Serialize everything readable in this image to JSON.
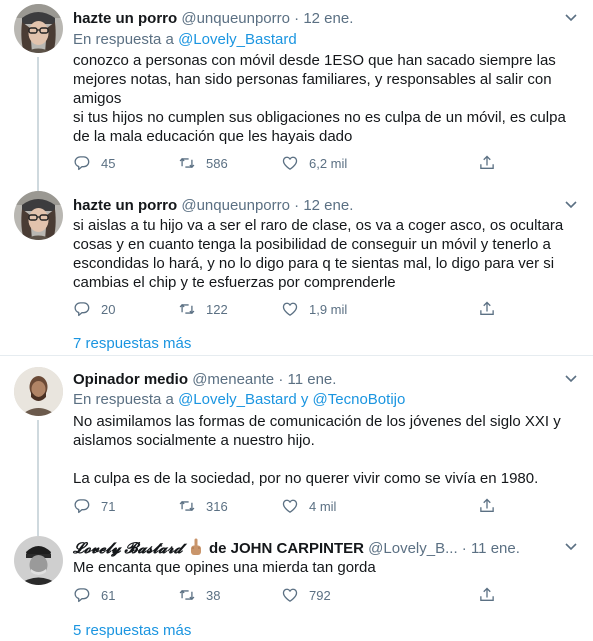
{
  "tweets": [
    {
      "name": "hazte un porro",
      "handle": "@unqueunporro",
      "sep": "·",
      "date": "12 ene.",
      "reply_prefix": "En respuesta a",
      "reply_to": "@Lovely_Bastard",
      "lines": [
        "conozco a personas con móvil desde 1ESO que han sacado siempre las mejores notas, han sido personas familiares, y responsables al salir con amigos",
        "si tus hijos no cumplen sus obligaciones no es culpa de un móvil, es culpa de la mala educación que les hayais dado"
      ],
      "replies": "45",
      "retweets": "586",
      "likes": "6,2 mil"
    },
    {
      "name": "hazte un porro",
      "handle": "@unqueunporro",
      "sep": "·",
      "date": "12 ene.",
      "text": "si aislas a tu hijo va a ser el raro de clase, os va a coger asco, os ocultara cosas y en cuanto tenga la posibilidad de conseguir un móvil y tenerlo a escondidas lo hará, y no lo digo para q te sientas mal, lo digo para ver si cambias el chip y te esfuerzas por comprenderle",
      "replies": "20",
      "retweets": "122",
      "likes": "1,9 mil",
      "more_replies": "7 respuestas más"
    },
    {
      "name": "Opinador medio",
      "handle": "@meneante",
      "sep": "·",
      "date": "11 ene.",
      "reply_prefix": "En respuesta a",
      "reply_to_1": "@Lovely_Bastard",
      "reply_and": "y",
      "reply_to_2": "@TecnoBotijo",
      "lines": [
        "No asimilamos las formas de comunicación de los jóvenes del siglo XXI y aislamos socialmente a nuestro hijo.",
        "La culpa es de la sociedad, por no querer vivir como se vivía en 1980."
      ],
      "replies": "71",
      "retweets": "316",
      "likes": "4 mil"
    },
    {
      "name_part1": "𝓛𝓸𝓿𝓮𝓵𝔂 𝓑𝓪𝓼𝓽𝓪𝓻𝓭",
      "name_part2": "de",
      "name_part3": "JOHN CARPINTER",
      "handle": "@Lovely_B...",
      "sep": "·",
      "date": "11 ene.",
      "text": "Me encanta que opines una mierda tan gorda",
      "replies": "61",
      "retweets": "38",
      "likes": "792",
      "more_replies": "5 respuestas más"
    }
  ],
  "icons": {
    "reply": "reply-icon",
    "retweet": "retweet-icon",
    "like": "heart-icon",
    "share": "share-icon",
    "menu": "chevron-down-icon"
  },
  "colors": {
    "link": "#1b95e0",
    "secondary": "#5b7083",
    "thread_line": "#cfd9de"
  }
}
